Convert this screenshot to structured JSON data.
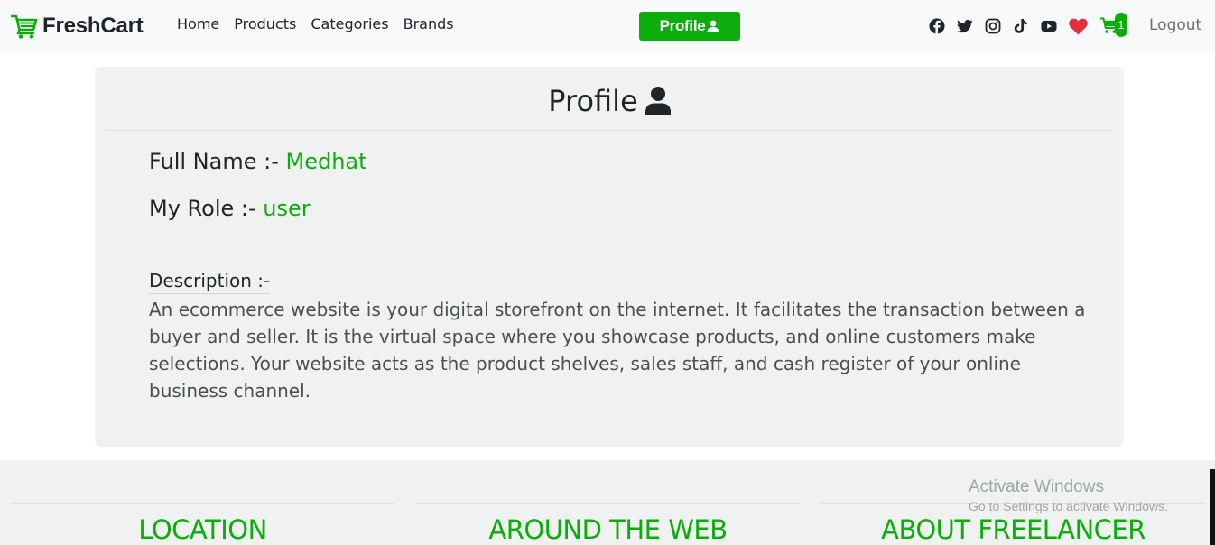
{
  "brand": {
    "name": "FreshCart",
    "icon": "cart-icon"
  },
  "nav": {
    "links": [
      "Home",
      "Products",
      "Categories",
      "Brands"
    ]
  },
  "profile_button": {
    "label": "Profile",
    "icon": "user-icon"
  },
  "social_icons": [
    "facebook-icon",
    "twitter-icon",
    "instagram-icon",
    "tiktok-icon",
    "youtube-icon"
  ],
  "wishlist": {
    "icon": "heart-icon"
  },
  "cart": {
    "icon": "cart-icon",
    "count": "1"
  },
  "logout_label": "Logout",
  "profile": {
    "title": "Profile",
    "name_label": "Full Name :- ",
    "name_value": "Medhat",
    "role_label": "My Role :- ",
    "role_value": "user",
    "description_label": "Description :-",
    "description": "An ecommerce website is your digital storefront on the internet. It facilitates the transaction between a buyer and seller. It is the virtual space where you showcase products, and online customers make selections. Your website acts as the product shelves, sales staff, and cash register of your online business channel."
  },
  "footer": {
    "headings": [
      "LOCATION",
      "AROUND THE WEB",
      "ABOUT FREELANCER"
    ]
  },
  "watermark": {
    "title": "Activate Windows",
    "subtitle": "Go to Settings to activate Windows."
  },
  "colors": {
    "accent": "#0aad0a",
    "heart": "#e52e3b",
    "card_bg": "#f0f2f1",
    "navbar_bg": "#f8f9fa"
  }
}
